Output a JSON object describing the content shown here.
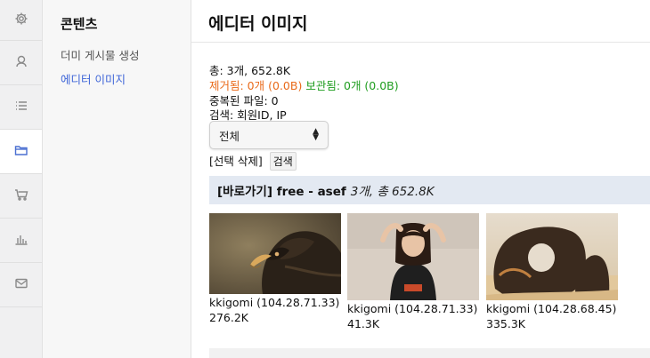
{
  "iconbar": {
    "items": [
      {
        "icon": "gear-icon",
        "active": false
      },
      {
        "icon": "user-icon",
        "active": false
      },
      {
        "icon": "list-icon",
        "active": false
      },
      {
        "icon": "folder-icon",
        "active": true
      },
      {
        "icon": "cart-icon",
        "active": false
      },
      {
        "icon": "bar-chart-icon",
        "active": false
      },
      {
        "icon": "mail-icon",
        "active": false
      }
    ],
    "active_color": "#4a6fd1"
  },
  "submenu": {
    "title": "콘텐츠",
    "items": [
      {
        "label": "더미 게시물 생성",
        "active": false
      },
      {
        "label": "에디터 이미지",
        "active": true
      }
    ]
  },
  "main": {
    "title": "에디터 이미지",
    "stats": {
      "total": "총: 3개, 652.8K",
      "removed": "제거됨: 0개 (0.0B)",
      "kept": "보관됨: 0개 (0.0B)",
      "duplicates": "중복된 파일: 0",
      "search_scope": "검색: 회원ID, IP"
    },
    "filter": {
      "selected": "전체"
    },
    "actions": {
      "delete_selected": "[선택 삭제]",
      "search": "검색"
    },
    "group": {
      "link_label": "[바로가기] free - asef",
      "summary": "3개, 총 652.8K"
    },
    "images": [
      {
        "subject": "eagle",
        "uploader": "kkigomi (104.28.71.33)",
        "size": "276.2K"
      },
      {
        "subject": "woman-portrait",
        "uploader": "kkigomi (104.28.71.33)",
        "size": "41.3K"
      },
      {
        "subject": "desert-rock-arch",
        "uploader": "kkigomi (104.28.68.45)",
        "size": "335.3K"
      }
    ]
  }
}
